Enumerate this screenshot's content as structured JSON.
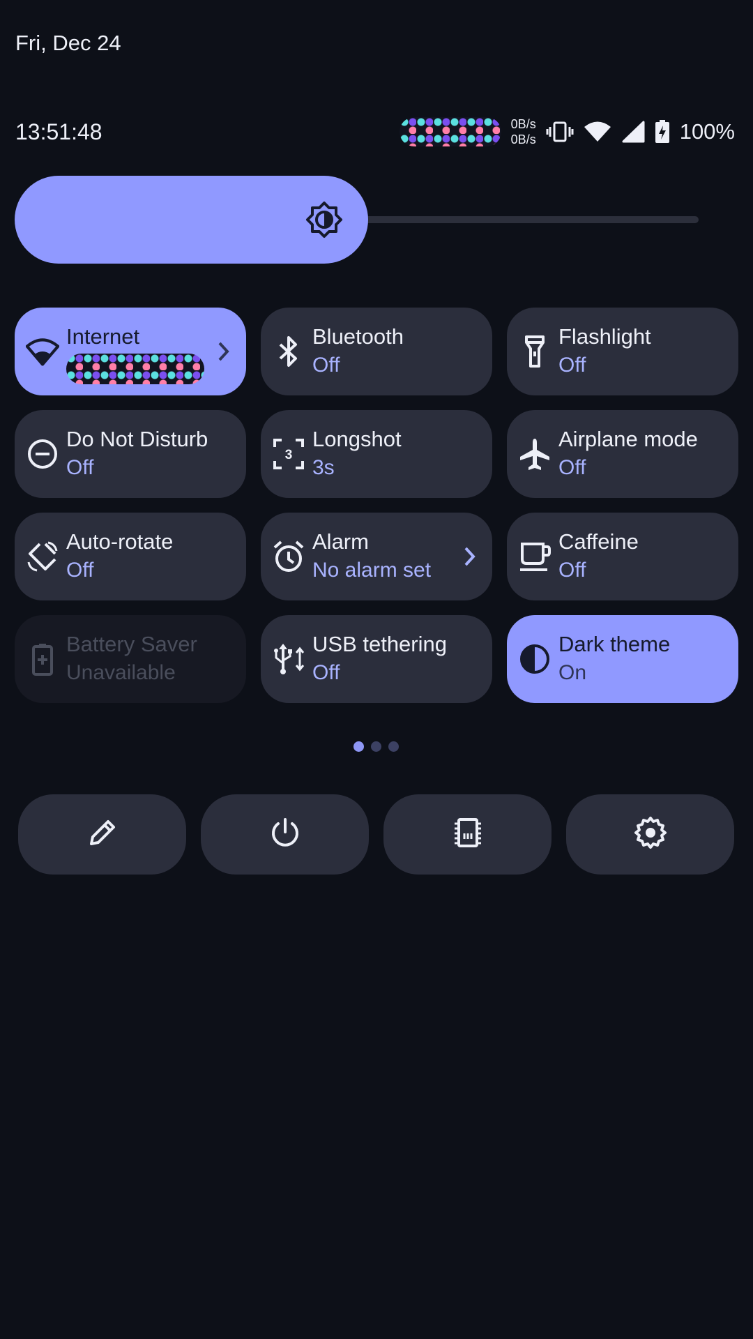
{
  "status": {
    "date": "Fri, Dec 24",
    "time": "13:51:48",
    "net_up": "0B/s",
    "net_down": "0B/s",
    "battery_percent": "100%"
  },
  "brightness": {
    "level": 0.5
  },
  "tiles": [
    {
      "label": "Internet",
      "state": "",
      "icon": "wifi-icon",
      "active": true,
      "chevron": true
    },
    {
      "label": "Bluetooth",
      "state": "Off",
      "icon": "bluetooth-icon"
    },
    {
      "label": "Flashlight",
      "state": "Off",
      "icon": "flashlight-icon"
    },
    {
      "label": "Do Not Disturb",
      "state": "Off",
      "icon": "do-not-disturb-icon"
    },
    {
      "label": "Longshot",
      "state": "3s",
      "icon": "longshot-icon"
    },
    {
      "label": "Airplane mode",
      "state": "Off",
      "icon": "airplane-icon"
    },
    {
      "label": "Auto-rotate",
      "state": "Off",
      "icon": "auto-rotate-icon"
    },
    {
      "label": "Alarm",
      "state": "No alarm set",
      "icon": "alarm-icon",
      "chevron": true
    },
    {
      "label": "Caffeine",
      "state": "Off",
      "icon": "coffee-cup-icon"
    },
    {
      "label": "Battery Saver",
      "state": "Unavailable",
      "icon": "battery-plus-icon",
      "disabled": true
    },
    {
      "label": "USB tethering",
      "state": "Off",
      "icon": "usb-icon"
    },
    {
      "label": "Dark theme",
      "state": "On",
      "icon": "dark-theme-icon",
      "active": true
    }
  ],
  "pager": {
    "pages": 3,
    "current": 1
  },
  "bottom_buttons": [
    {
      "icon": "pencil-icon",
      "name": "edit-button"
    },
    {
      "icon": "power-icon",
      "name": "power-button"
    },
    {
      "icon": "memory-chip-icon",
      "name": "memory-button"
    },
    {
      "icon": "gear-icon",
      "name": "settings-button"
    }
  ],
  "colors": {
    "background": "#0d1018",
    "tile": "#2b2e3c",
    "accent": "#9099ff",
    "state_text": "#a9b3ff"
  }
}
